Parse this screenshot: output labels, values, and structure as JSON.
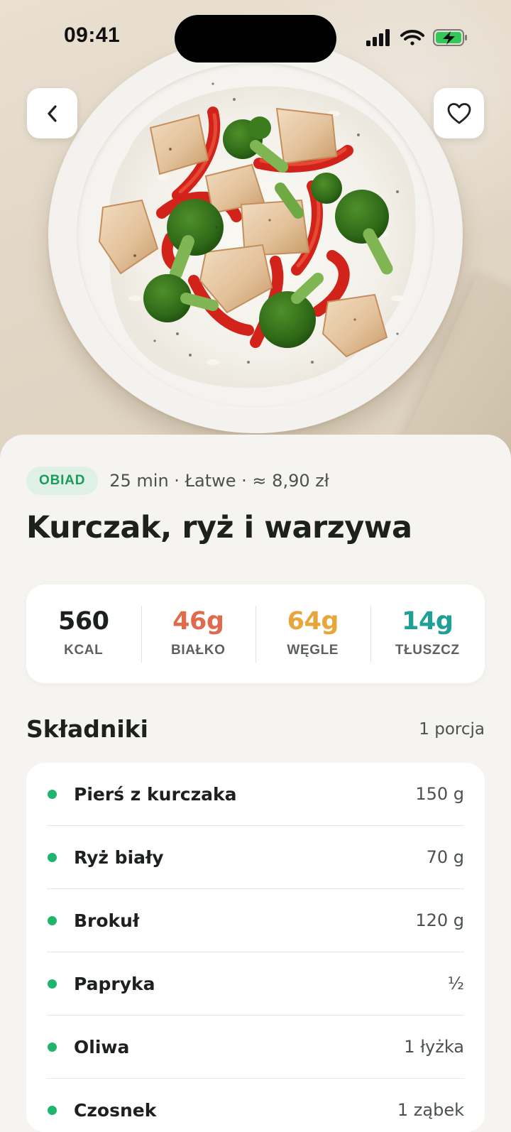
{
  "status_bar": {
    "time": "09:41"
  },
  "recipe": {
    "category": "OBIAD",
    "meta": "25 min · Łatwe · ≈ 8,90 zł",
    "title": "Kurczak, ryż i warzywa"
  },
  "macros": [
    {
      "value": "560",
      "label": "KCAL",
      "color": "#1c211e"
    },
    {
      "value": "46g",
      "label": "BIAŁKO",
      "color": "#e06a4e"
    },
    {
      "value": "64g",
      "label": "WĘGLE",
      "color": "#e8a63a"
    },
    {
      "value": "14g",
      "label": "TŁUSZCZ",
      "color": "#1f9f96"
    }
  ],
  "ingredients_section": {
    "title": "Składniki",
    "servings": "1 porcja",
    "items": [
      {
        "name": "Pierś z kurczaka",
        "amount": "150 g"
      },
      {
        "name": "Ryż biały",
        "amount": "70 g"
      },
      {
        "name": "Brokuł",
        "amount": "120 g"
      },
      {
        "name": "Papryka",
        "amount": "½"
      },
      {
        "name": "Oliwa",
        "amount": "1 łyżka"
      },
      {
        "name": "Czosnek",
        "amount": "1 ząbek"
      }
    ]
  },
  "icons": {
    "back": "chevron-left-icon",
    "favorite": "heart-icon",
    "signal": "signal-icon",
    "wifi": "wifi-icon",
    "battery": "battery-charging-icon"
  },
  "colors": {
    "accent_green": "#21b46d",
    "tag_bg": "#dff1e6"
  }
}
